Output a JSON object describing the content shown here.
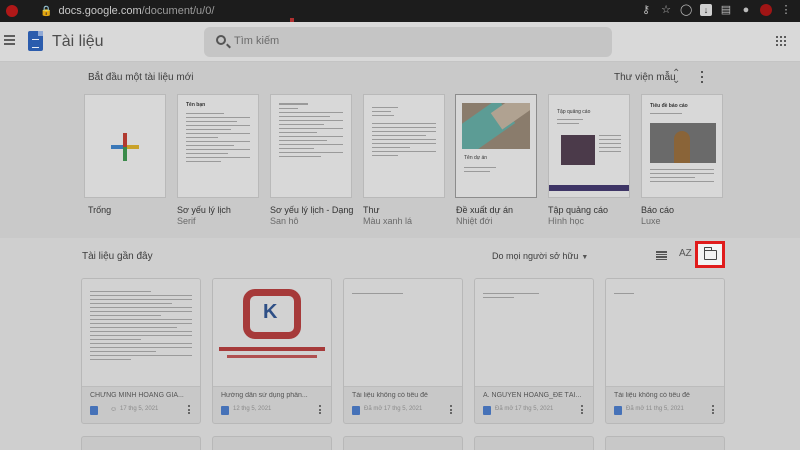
{
  "browser": {
    "url_domain": "docs.google.com",
    "url_path": "/document/u/0/"
  },
  "header": {
    "app_title": "Tài liệu",
    "search_placeholder": "Tìm kiếm"
  },
  "gallery": {
    "heading": "Bắt đầu một tài liệu mới",
    "library_label": "Thư viện mẫu",
    "templates": [
      {
        "name": "Trống",
        "subtitle": ""
      },
      {
        "name": "Sơ yếu lý lịch",
        "subtitle": "Serif"
      },
      {
        "name": "Sơ yếu lý lịch - Dạng",
        "subtitle": "San hô"
      },
      {
        "name": "Thư",
        "subtitle": "Màu xanh lá"
      },
      {
        "name": "Đề xuất dự án",
        "subtitle": "Nhiệt đới"
      },
      {
        "name": "Tập quảng cáo",
        "subtitle": "Hình học"
      },
      {
        "name": "Báo cáo",
        "subtitle": "Luxe"
      }
    ],
    "thumb_text": {
      "resume_name": "Tên bạn",
      "project_name": "Tên dự án",
      "brochure_title": "Tập quảng cáo",
      "report_title": "Tiêu đề báo cáo"
    }
  },
  "recent": {
    "heading": "Tài liệu gần đây",
    "owner_filter": "Do mọi người sở hữu",
    "sort_label": "AZ",
    "docs": [
      {
        "title": "CHỨNG MINH HOÀNG GIA...",
        "meta": "17 thg 5, 2021"
      },
      {
        "title": "Hướng dẫn sử dụng phần...",
        "meta": "12 thg 5, 2021"
      },
      {
        "title": "Tài liệu không có tiêu đề",
        "meta": "Đã mở 17 thg 5, 2021"
      },
      {
        "title": "A. NGUYỄN HOÀNG_ĐỀ TÀI...",
        "meta": "Đã mở 17 thg 5, 2021"
      },
      {
        "title": "Tài liệu không có tiêu đề",
        "meta": "Đã mở 11 thg 5, 2021"
      }
    ]
  },
  "colors": {
    "highlight": "#e01b1b",
    "docs_blue": "#4672b8"
  }
}
